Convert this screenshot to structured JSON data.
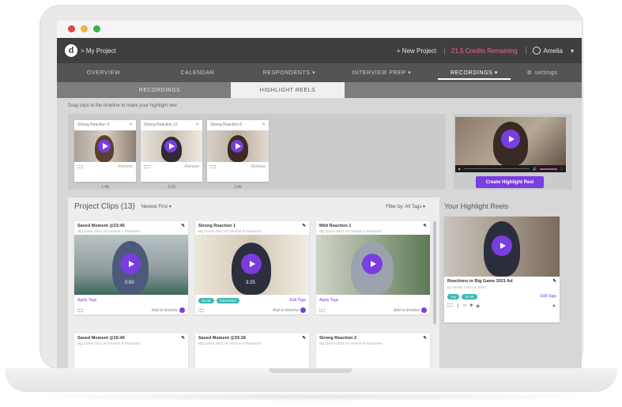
{
  "window": {
    "dots": [
      "#e0443e",
      "#f3b33d",
      "#35b34a"
    ]
  },
  "topbar": {
    "logo": "d",
    "breadcrumb": "> My Project",
    "new_project": "+ New Project",
    "credits": "21.5 Credits Remaining",
    "user": "Amelia"
  },
  "nav": {
    "items": [
      "OVERVIEW",
      "CALENDAR",
      "RESPONDENTS ▾",
      "INTERVIEW PREP ▾",
      "RECORDINGS ▾"
    ],
    "settings": "settings"
  },
  "subnav": {
    "tabs": [
      "RECORDINGS",
      "HIGHLIGHT REELS"
    ]
  },
  "tray": {
    "hint": "Drag clips to the timeline to make your highlight reel",
    "clips": [
      {
        "title": "Strong Reaction 4",
        "remove": "Remove",
        "duration": "1:45"
      },
      {
        "title": "Strong Reaction 12",
        "remove": "Remove",
        "duration": "3:33"
      },
      {
        "title": "Strong Reaction 6",
        "remove": "Remove",
        "duration": "2:42"
      }
    ]
  },
  "preview": {
    "create_button": "Create Highlight Reel"
  },
  "project_clips": {
    "title": "Project Clips (13)",
    "sort": "Newest First ▾",
    "filter": "Filter by: All Tags ▾",
    "cards": [
      {
        "title": "Saved Moment @23:45",
        "sub": "Big Game 2021 Ad Version A Reactions",
        "time": "0:50",
        "apply": "Apply Tags",
        "add": "Add to timeline"
      },
      {
        "title": "Strong Reaction 1",
        "sub": "Big Game 2021 Ad Version B Reactions",
        "time": "3:25",
        "tags": [
          "18-45",
          "Discomfort"
        ],
        "edit": "Edit Tags",
        "add": "Add to timeline"
      },
      {
        "title": "Mild Reaction 1",
        "sub": "Big Game 2021 Ad Version A Reactions",
        "apply": "Apply Tags",
        "add": "Add to timeline"
      }
    ],
    "bottom_cards": [
      {
        "title": "Saved Moment @15:45",
        "sub": "Big Game 2021 Ad Version B Reactions"
      },
      {
        "title": "Saved Moment @33:18",
        "sub": "Big Game 2021 Ad Version B Reactions"
      },
      {
        "title": "Strong Reaction 2",
        "sub": "Big Game 2021 Ad Version B Reactions"
      }
    ]
  },
  "highlight_reels": {
    "title": "Your Highlight Reels",
    "reel": {
      "title": "Reactions to Big Game 2021 Ad",
      "meta": "by Amelia | Oct 14, 2020",
      "tags": [
        "Joy",
        "18-45"
      ],
      "edit": "Edit Tags"
    }
  },
  "colors": {
    "accent": "#7a3de0",
    "tag": "#3cb8b2",
    "credits": "#e86a8a"
  }
}
